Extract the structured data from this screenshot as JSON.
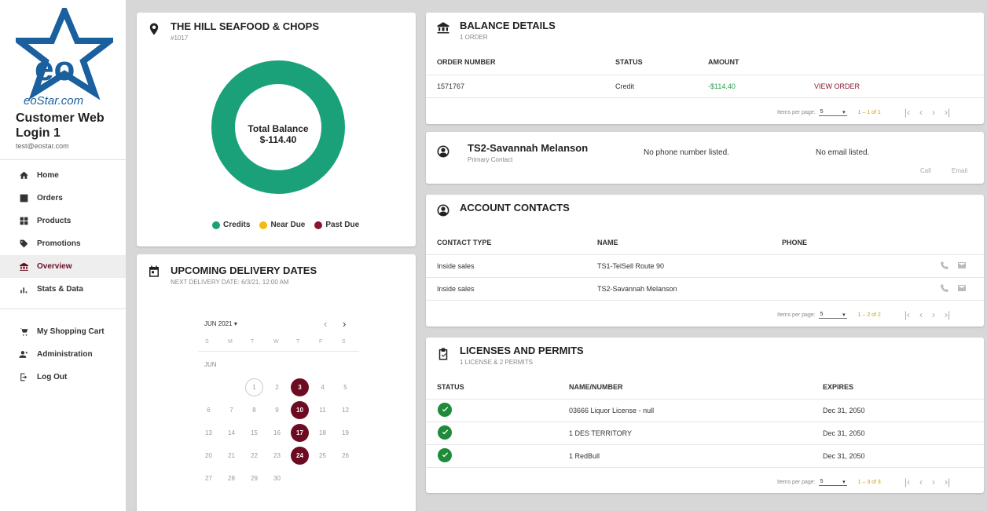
{
  "sidebar": {
    "logo_text": "eoStar.com",
    "user_name": "Customer Web Login 1",
    "user_email": "test@eostar.com",
    "nav": [
      {
        "label": "Home",
        "icon": "home-icon"
      },
      {
        "label": "Orders",
        "icon": "orders-icon"
      },
      {
        "label": "Products",
        "icon": "products-icon"
      },
      {
        "label": "Promotions",
        "icon": "tag-icon"
      },
      {
        "label": "Overview",
        "icon": "bank-icon",
        "active": true
      },
      {
        "label": "Stats & Data",
        "icon": "bar-chart-icon"
      }
    ],
    "nav2": [
      {
        "label": "My Shopping Cart",
        "icon": "cart-icon"
      },
      {
        "label": "Administration",
        "icon": "admin-icon"
      },
      {
        "label": "Log Out",
        "icon": "logout-icon"
      }
    ]
  },
  "customer": {
    "name": "THE HILL SEAFOOD & CHOPS",
    "number": "#1017",
    "total_label": "Total Balance",
    "total_value": "$-114.40",
    "legend": [
      {
        "label": "Credits",
        "color": "#1aa17a"
      },
      {
        "label": "Near Due",
        "color": "#f5b914"
      },
      {
        "label": "Past Due",
        "color": "#8b1530"
      }
    ],
    "donut_share": {
      "credits": 1.0,
      "near_due": 0.0,
      "past_due": 0.0
    }
  },
  "delivery": {
    "title": "UPCOMING DELIVERY DATES",
    "subtitle": "NEXT DELIVERY DATE: 6/3/21, 12:00 AM",
    "month": "JUN 2021",
    "month_short": "JUN",
    "weekdays": [
      "S",
      "M",
      "T",
      "W",
      "T",
      "F",
      "S"
    ],
    "weeks": [
      [
        "",
        "",
        "1",
        "2",
        "3",
        "4",
        "5"
      ],
      [
        "6",
        "7",
        "8",
        "9",
        "10",
        "11",
        "12"
      ],
      [
        "13",
        "14",
        "15",
        "16",
        "17",
        "18",
        "19"
      ],
      [
        "20",
        "21",
        "22",
        "23",
        "24",
        "25",
        "26"
      ],
      [
        "27",
        "28",
        "29",
        "30",
        "",
        "",
        ""
      ]
    ],
    "highlighted": [
      "3",
      "10",
      "17",
      "24"
    ],
    "today": "1"
  },
  "balance": {
    "title": "BALANCE DETAILS",
    "subtitle": "1 ORDER",
    "headers": [
      "ORDER NUMBER",
      "STATUS",
      "AMOUNT"
    ],
    "rows": [
      {
        "order": "1571767",
        "status": "Credit",
        "amount": "-$114.40",
        "action": "VIEW ORDER"
      }
    ],
    "pager": {
      "label": "Items per page:",
      "size": "5",
      "range": "1 – 1 of 1"
    }
  },
  "primary_contact": {
    "name": "TS2-Savannah Melanson",
    "role": "Primary Contact",
    "phone": "No phone number listed.",
    "email": "No email listed.",
    "call": "Call",
    "email_btn": "Email"
  },
  "contacts": {
    "title": "ACCOUNT CONTACTS",
    "headers": [
      "CONTACT TYPE",
      "NAME",
      "PHONE"
    ],
    "rows": [
      {
        "type": "Inside sales",
        "name": "TS1-TelSell Route 90"
      },
      {
        "type": "Inside sales",
        "name": "TS2-Savannah Melanson"
      }
    ],
    "pager": {
      "label": "Items per page:",
      "size": "5",
      "range": "1 – 2 of 2"
    }
  },
  "licenses": {
    "title": "LICENSES AND PERMITS",
    "subtitle": "1 LICENSE & 2 PERMITS",
    "headers": [
      "STATUS",
      "NAME/NUMBER",
      "EXPIRES"
    ],
    "rows": [
      {
        "name": "03666 Liquor License - null",
        "expires": "Dec 31, 2050"
      },
      {
        "name": "1 DES TERRITORY",
        "expires": "Dec 31, 2050"
      },
      {
        "name": "1 RedBull",
        "expires": "Dec 31, 2050"
      }
    ],
    "pager": {
      "label": "Items per page:",
      "size": "5",
      "range": "1 – 3 of 3"
    }
  }
}
